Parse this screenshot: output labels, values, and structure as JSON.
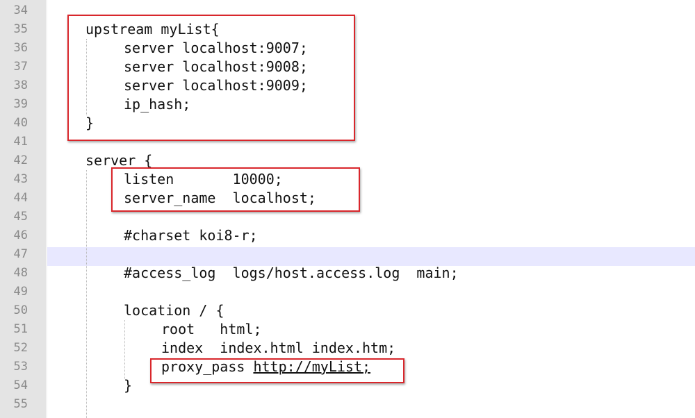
{
  "editor": {
    "line_numbers": [
      "34",
      "35",
      "36",
      "37",
      "38",
      "39",
      "40",
      "41",
      "42",
      "43",
      "44",
      "45",
      "46",
      "47",
      "48",
      "49",
      "50",
      "51",
      "52",
      "53",
      "54",
      "55"
    ],
    "lines": {
      "l35": "upstream myList{",
      "l36": "server localhost:9007;",
      "l37": "server localhost:9008;",
      "l38": "server localhost:9009;",
      "l39": "ip_hash;",
      "l40": "}",
      "l42": "server {",
      "l43": "listen       10000;",
      "l44": "server_name  localhost;",
      "l46": "#charset koi8-r;",
      "l48": "#access_log  logs/host.access.log  main;",
      "l50": "location / {",
      "l51": "root   html;",
      "l52": "index  index.html index.htm;",
      "l53_prefix": "proxy_pass ",
      "l53_url": "http://myList;",
      "l54": "}"
    },
    "current_line": "47",
    "colors": {
      "gutter_bg": "#e4e4e4",
      "line_number": "#8a8a8a",
      "current_line_bg": "#e8e8ff",
      "annotation_box": "#d9262b"
    }
  }
}
